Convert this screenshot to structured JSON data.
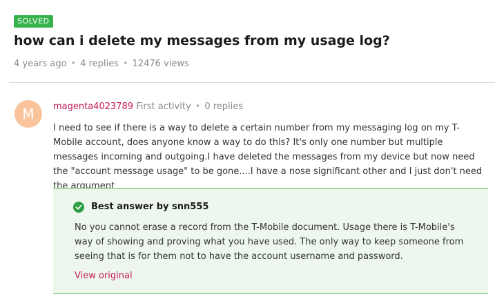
{
  "thread": {
    "status_badge": "SOLVED",
    "title": "how can i delete my messages from my usage log?",
    "age": "4 years ago",
    "replies": "4 replies",
    "views": "12476 views",
    "meta_separator": "•"
  },
  "post": {
    "avatar_letter": "M",
    "username": "magenta4023789",
    "activity": "First activity",
    "replies": "0 replies",
    "body": "I need to see if there is a way to delete a certain number from my messaging log on my T-Mobile account, does anyone know a way to do this? It's only one number but multiple messages incoming and outgoing.I have deleted the messages from my device but now need the \"account message usage\" to be gone....I have a nose significant other and I just don't need the argument"
  },
  "best_answer": {
    "heading": "Best answer by snn555",
    "body": "No you cannot erase a record from the T-Mobile document. Usage there is T-Mobile's way of showing and proving what you have used. The only way to keep someone from seeing that is for them not to have the account username and password.",
    "link_label": "View original"
  },
  "colors": {
    "solved_green": "#37b24d",
    "username_magenta": "#c2185b",
    "avatar_peach": "#f9c49c",
    "answer_bg": "#eef7ee",
    "answer_border": "#5bb55b"
  }
}
